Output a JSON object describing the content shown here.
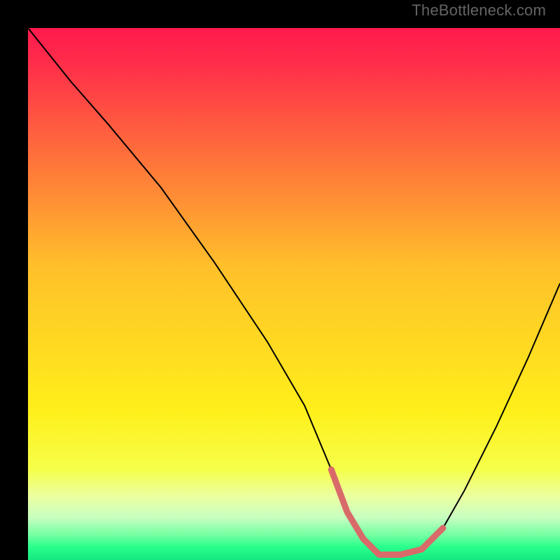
{
  "watermark": "TheBottleneck.com",
  "chart_data": {
    "type": "line",
    "title": "",
    "xlabel": "",
    "ylabel": "",
    "xlim": [
      0,
      100
    ],
    "ylim": [
      0,
      100
    ],
    "background_gradient": {
      "stops": [
        {
          "offset": 0.0,
          "color": "#ff1a4d"
        },
        {
          "offset": 0.06,
          "color": "#ff2b4a"
        },
        {
          "offset": 0.45,
          "color": "#ffc02a"
        },
        {
          "offset": 0.72,
          "color": "#ffef1a"
        },
        {
          "offset": 0.83,
          "color": "#f5ff4a"
        },
        {
          "offset": 0.88,
          "color": "#ecffa0"
        },
        {
          "offset": 0.92,
          "color": "#c8ffc0"
        },
        {
          "offset": 0.955,
          "color": "#6effa0"
        },
        {
          "offset": 0.975,
          "color": "#2aff8c"
        },
        {
          "offset": 1.0,
          "color": "#14e880"
        }
      ]
    },
    "series": [
      {
        "name": "bottleneck-curve",
        "stroke": "#000000",
        "stroke_width": 2,
        "x": [
          0,
          8,
          15,
          25,
          35,
          45,
          52,
          57,
          60,
          63,
          66,
          70,
          74,
          78,
          82,
          88,
          94,
          100
        ],
        "y": [
          100,
          90,
          82,
          70,
          56,
          41,
          29,
          17,
          9,
          4,
          1,
          1,
          2,
          6,
          13,
          25,
          38,
          52
        ]
      },
      {
        "name": "highlight-band",
        "stroke": "#d96a6a",
        "stroke_width": 9,
        "linecap": "round",
        "x": [
          57,
          60,
          63,
          66,
          70,
          74,
          78
        ],
        "y": [
          17,
          9,
          4,
          1,
          1,
          2,
          6
        ]
      }
    ]
  }
}
